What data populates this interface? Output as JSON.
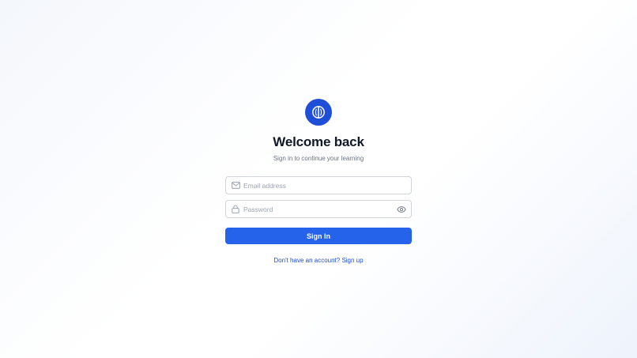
{
  "brand": {
    "logo_icon": "brain-icon",
    "logo_color": "#1f4fd8"
  },
  "header": {
    "title": "Welcome back",
    "subtitle": "Sign in to continue your learning"
  },
  "form": {
    "email": {
      "icon": "mail-icon",
      "value": "",
      "placeholder": "Email address"
    },
    "password": {
      "icon": "lock-icon",
      "value": "",
      "placeholder": "Password",
      "toggle_icon": "eye-icon"
    },
    "submit_label": "Sign In",
    "submit_color": "#2563eb"
  },
  "footer": {
    "signup_link": "Don't have an account? Sign up",
    "link_color": "#1d4ed8"
  }
}
